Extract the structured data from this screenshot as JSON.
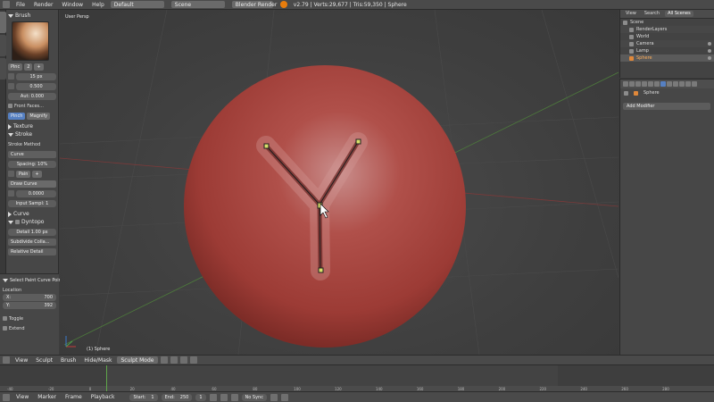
{
  "topbar": {
    "menus": [
      "File",
      "Render",
      "Window",
      "Help"
    ],
    "layout": "Default",
    "scene": "Scene",
    "engine": "Blender Render",
    "stats": "v2.79 | Verts:29,677 | Tris:59,350 | Sphere"
  },
  "shelf": {
    "brush_header": "Brush",
    "brush_name": "Pinc",
    "brush_users": "2",
    "radius": "15 px",
    "strength": "0.500",
    "autosmooth": "Aut: 0.000",
    "front_faces": "Front Faces...",
    "pinch_btn": "Pinch",
    "magnify_btn": "Magnify",
    "texture": "Texture",
    "stroke": "Stroke",
    "stroke_method_label": "Stroke Method",
    "stroke_method": "Curve",
    "spacing": "Spacing: 10%",
    "curve_name": "Pain",
    "draw_curve": "Draw Curve",
    "jitter": "0.0000",
    "input_samples": "Input Sampl: 1",
    "curve": "Curve",
    "dyntopo": "Dyntopo",
    "detail": "Detail 1.00 px",
    "subdivide": "Subdivide Colla...",
    "relative_detail": "Relative Detail"
  },
  "redo": {
    "title": "Select Paint Curve Point",
    "location_label": "Location",
    "x_label": "X:",
    "x_value": "700",
    "y_label": "Y:",
    "y_value": "392",
    "toggle": "Toggle",
    "extend": "Extend"
  },
  "viewport": {
    "view_label": "User Persp",
    "object_label": "(1) Sphere"
  },
  "outliner": {
    "tabs": [
      "View",
      "Search",
      "All Scenes"
    ],
    "rows": [
      "Scene",
      "RenderLayers",
      "World",
      "Camera",
      "Lamp",
      "Sphere"
    ]
  },
  "properties": {
    "object": "Sphere",
    "add_modifier": "Add Modifier"
  },
  "vp_header": {
    "items": [
      "View",
      "Sculpt",
      "Brush",
      "Hide/Mask"
    ],
    "mode": "Sculpt Mode"
  },
  "timeline": {
    "ticks": [
      "-40",
      "-20",
      "0",
      "20",
      "40",
      "60",
      "80",
      "100",
      "120",
      "140",
      "160",
      "180",
      "200",
      "220",
      "240",
      "260",
      "280"
    ]
  },
  "footer": {
    "items": [
      "View",
      "Marker",
      "Frame",
      "Playback"
    ],
    "start_label": "Start:",
    "start": "1",
    "end_label": "End:",
    "end": "250",
    "current": "1",
    "sync": "No Sync"
  },
  "colors": {
    "sphere": "#a9423c",
    "accent": "#5680c2",
    "curve_point": "#d8e06a"
  }
}
